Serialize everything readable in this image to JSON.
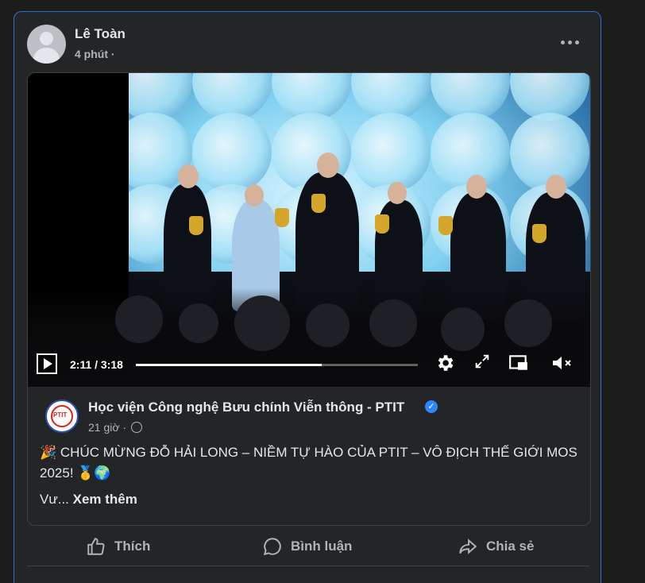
{
  "post": {
    "author": "Lê Toàn",
    "time": "4 phút ·",
    "more_icon": "more-horizontal-icon"
  },
  "video": {
    "current_time": "2:11 / 3:18",
    "progress": 0.66,
    "icons": [
      "play-icon",
      "settings-icon",
      "fullscreen-icon",
      "picture-in-picture-icon",
      "mute-icon"
    ]
  },
  "shared": {
    "page_name": "Học viện Công nghệ Bưu chính Viễn thông - PTIT",
    "logo_text": "PTIT",
    "time": "21 giờ ·",
    "text": "🎉 CHÚC MỪNG ĐỖ HẢI LONG – NIỀM TỰ HÀO CỦA PTIT – VÔ ĐỊCH THẾ GIỚI MOS 2025! 🥇🌍",
    "truncated": "Vư...",
    "see_more": "Xem thêm"
  },
  "actions": {
    "like": "Thích",
    "comment": "Bình luận",
    "share": "Chia sẻ"
  },
  "colors": {
    "background": "#242526",
    "accent": "#2d88ff",
    "border": "#2d6fd8"
  }
}
